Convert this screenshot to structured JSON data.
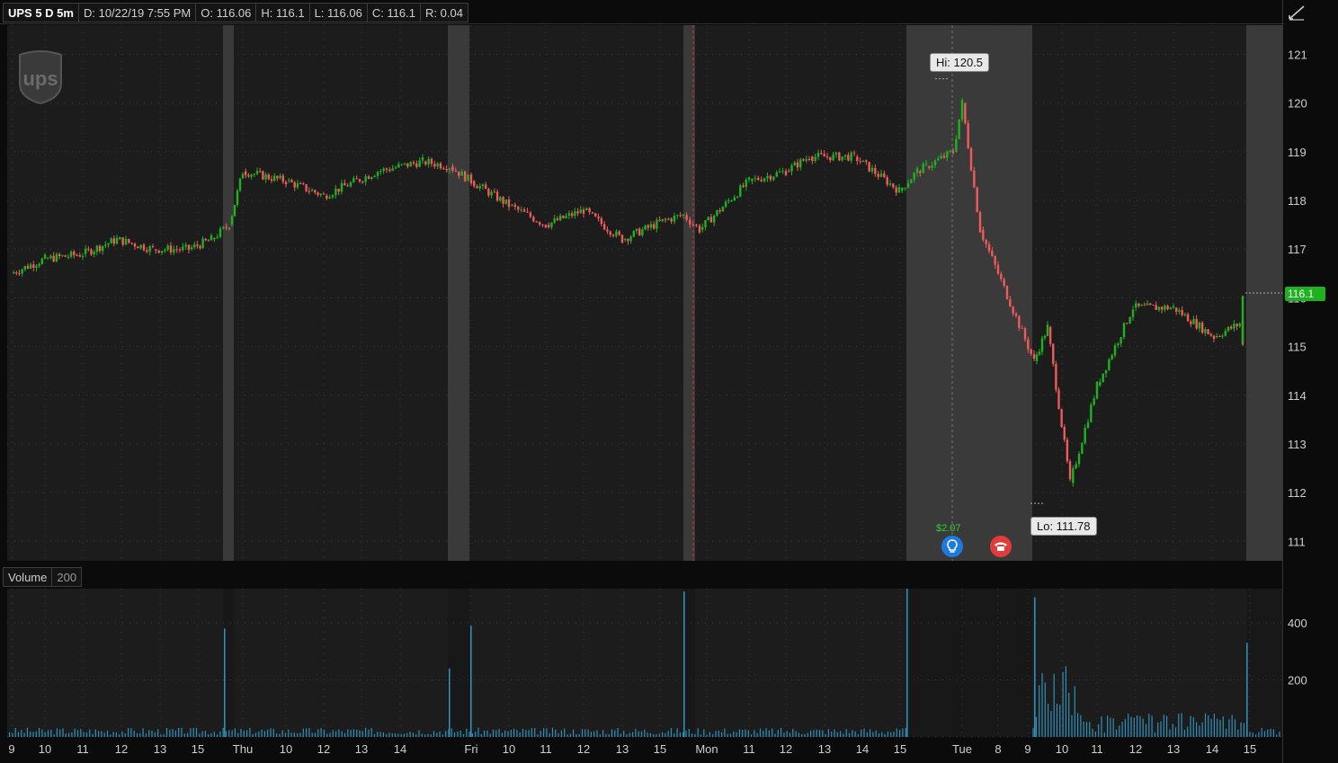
{
  "header": {
    "symbol": "UPS 5 D 5m",
    "date": "D: 10/22/19 7:55 PM",
    "open": "O: 116.06",
    "high": "H: 116.1",
    "low": "L: 116.06",
    "close": "C: 116.1",
    "range": "R: 0.04"
  },
  "logo_text": "ups",
  "volume_panel": {
    "label": "Volume",
    "length": "200"
  },
  "annotations": {
    "hi": "Hi: 120.5",
    "lo": "Lo: 111.78",
    "eps": "$2.07"
  },
  "last_price_tag": "116.1",
  "icons": {
    "bulb": "lightbulb-icon",
    "phone": "phone-icon",
    "draw": "drawing-tool-icon"
  },
  "colors": {
    "up": "#1fb11f",
    "down": "#f05a5a",
    "volume": "#2f8fb8",
    "bg": "#1c1c1c",
    "extended": "#3a3a3a"
  },
  "chart_data": {
    "type": "candlestick",
    "title": "UPS 5 D 5m",
    "price_axis": {
      "ticks": [
        111,
        112,
        113,
        114,
        115,
        116,
        117,
        118,
        119,
        120,
        121
      ],
      "range": [
        110.6,
        121.6
      ]
    },
    "volume_axis": {
      "ticks": [
        0,
        200,
        400
      ],
      "range": [
        0,
        520
      ]
    },
    "x_ticks": [
      "9",
      "10",
      "11",
      "12",
      "13",
      "15",
      "Thu",
      "10",
      "12",
      "13",
      "14",
      "Fri",
      "10",
      "11",
      "12",
      "13",
      "15",
      "Mon",
      "11",
      "12",
      "13",
      "14",
      "15",
      "Tue",
      "8",
      "9",
      "10",
      "11",
      "12",
      "13",
      "14",
      "15"
    ],
    "shaded_sessions": [
      "Wed extended hours",
      "Thu extended hours",
      "Fri extended hours",
      "Mon extended hours",
      "Tue pre-market",
      "Tue after-hours"
    ],
    "series_points": [
      [
        "Wed 9:30",
        116.5
      ],
      [
        "Wed 10",
        116.8
      ],
      [
        "Wed 11",
        116.9
      ],
      [
        "Wed 12",
        117.2
      ],
      [
        "Wed 13",
        117.0
      ],
      [
        "Wed 14",
        117.0
      ],
      [
        "Wed 15",
        117.2
      ],
      [
        "Wed 16",
        117.5
      ],
      [
        "Thu 9:30",
        118.6
      ],
      [
        "Thu 10",
        118.4
      ],
      [
        "Thu 11",
        118.1
      ],
      [
        "Thu 12",
        118.6
      ],
      [
        "Thu 13",
        118.8
      ],
      [
        "Thu 14",
        118.7
      ],
      [
        "Thu 16",
        118.4
      ],
      [
        "Fri 9:30",
        117.9
      ],
      [
        "Fri 10",
        117.5
      ],
      [
        "Fri 11",
        117.8
      ],
      [
        "Fri 12",
        117.2
      ],
      [
        "Fri 13",
        117.6
      ],
      [
        "Fri 14",
        117.7
      ],
      [
        "Fri 15",
        117.4
      ],
      [
        "Mon 9:30",
        118.4
      ],
      [
        "Mon 11",
        118.6
      ],
      [
        "Mon 12",
        118.9
      ],
      [
        "Mon 13",
        118.9
      ],
      [
        "Mon 14",
        118.2
      ],
      [
        "Mon 15",
        118.6
      ],
      [
        "Mon 16",
        118.7
      ],
      [
        "Tue pre 7",
        119.0
      ],
      [
        "Tue pre 7:30",
        120.0
      ],
      [
        "Tue pre 8",
        117.4
      ],
      [
        "Tue pre 8:30",
        114.7
      ],
      [
        "Tue pre 9",
        115.4
      ],
      [
        "Tue 9:30",
        112.2
      ],
      [
        "Tue 10",
        114.2
      ],
      [
        "Tue 10:30",
        115.8
      ],
      [
        "Tue 11",
        115.8
      ],
      [
        "Tue 12",
        115.2
      ],
      [
        "Tue 13",
        115.5
      ],
      [
        "Tue 14",
        115.1
      ],
      [
        "Tue 15",
        115.4
      ],
      [
        "Tue 16",
        116.1
      ]
    ],
    "high": 120.5,
    "low": 111.78,
    "last": 116.1,
    "volume_spikes": [
      [
        "Wed 16",
        380
      ],
      [
        "Thu 16",
        240
      ],
      [
        "Fri 16",
        390
      ],
      [
        "Mon 16",
        510
      ],
      [
        "Tue 9:30",
        490
      ],
      [
        "Tue 16",
        330
      ]
    ]
  }
}
